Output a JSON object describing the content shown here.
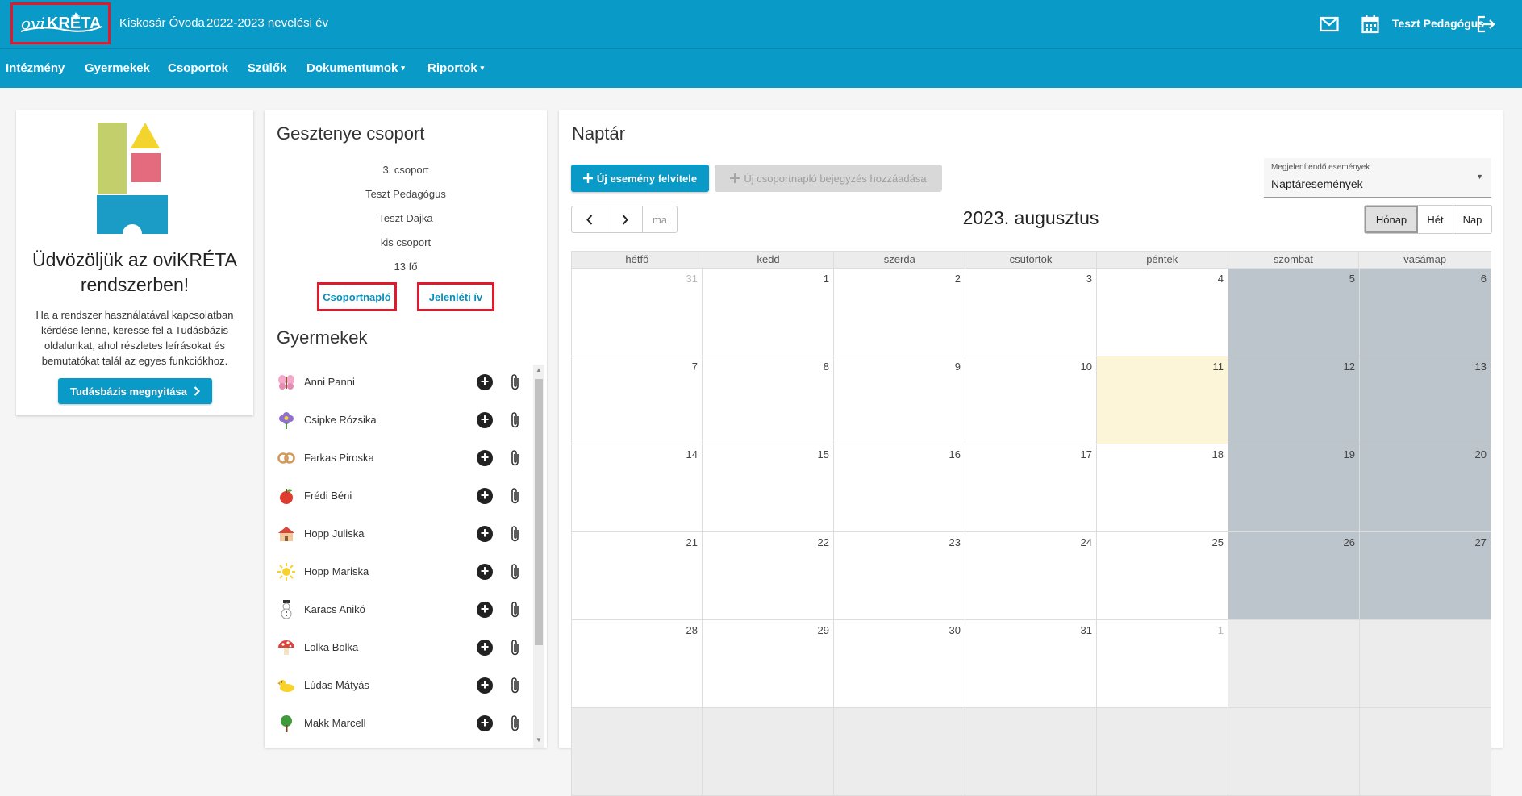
{
  "header": {
    "logo_text": "oviKRÉTA",
    "school": "Kiskosár Óvoda",
    "year": "2022-2023 nevelési év",
    "user": "Teszt Pedagógus",
    "icons": [
      "mail-icon",
      "calendar-icon",
      "logout-icon"
    ]
  },
  "nav": {
    "items": [
      "Intézmény",
      "Gyermekek",
      "Csoportok",
      "Szülők",
      "Dokumentumok",
      "Riportok"
    ],
    "dropdown_caret": "▾"
  },
  "welcome": {
    "title": "Üdvözöljük az oviKRÉTA rendszerben!",
    "text": "Ha a rendszer használatával kapcsolatban kérdése lenne, keresse fel a Tudásbázis oldalunkat, ahol részletes leírásokat és bemutatókat talál az egyes funkciókhoz.",
    "button": "Tudásbázis megnyitása"
  },
  "group": {
    "title": "Gesztenye csoport",
    "number": "3. csoport",
    "teacher": "Teszt Pedagógus",
    "nanny": "Teszt Dajka",
    "type": "kis csoport",
    "size": "13 fő",
    "journal_button": "Csoportnapló",
    "attendance_button": "Jelenléti ív"
  },
  "children": {
    "title": "Gyermekek",
    "list": [
      {
        "name": "Anni Panni",
        "icon": "butterfly-icon"
      },
      {
        "name": "Csipke Rózsika",
        "icon": "flower-icon"
      },
      {
        "name": "Farkas Piroska",
        "icon": "pretzel-icon"
      },
      {
        "name": "Frédi Béni",
        "icon": "apple-icon"
      },
      {
        "name": "Hopp Juliska",
        "icon": "house-icon"
      },
      {
        "name": "Hopp Mariska",
        "icon": "sun-icon"
      },
      {
        "name": "Karacs Anikó",
        "icon": "snowman-icon"
      },
      {
        "name": "Lolka Bolka",
        "icon": "mushroom-icon"
      },
      {
        "name": "Lúdas Mátyás",
        "icon": "duck-icon"
      },
      {
        "name": "Makk Marcell",
        "icon": "tree-icon"
      }
    ]
  },
  "calendar": {
    "title": "Naptár",
    "new_event": "Új esemény felvitele",
    "new_journal": "Új csoportnapló bejegyzés hozzáadása",
    "events_label": "Megjelenítendő események",
    "events_value": "Naptáresemények",
    "today_button": "ma",
    "month": "2023. augusztus",
    "views": [
      "Hónap",
      "Hét",
      "Nap"
    ],
    "weekdays": [
      "hétfő",
      "kedd",
      "szerda",
      "csütörtök",
      "péntek",
      "szombat",
      "vasámap"
    ],
    "weeks": [
      [
        "31",
        "1",
        "2",
        "3",
        "4",
        "5",
        "6"
      ],
      [
        "7",
        "8",
        "9",
        "10",
        "11",
        "12",
        "13"
      ],
      [
        "14",
        "15",
        "16",
        "17",
        "18",
        "19",
        "20"
      ],
      [
        "21",
        "22",
        "23",
        "24",
        "25",
        "26",
        "27"
      ],
      [
        "28",
        "29",
        "30",
        "31",
        "1",
        "",
        ""
      ],
      [
        "",
        "",
        "",
        "",
        "",
        "",
        ""
      ]
    ],
    "today": "11",
    "colors": {
      "accent": "#0a9ac7",
      "weekend": "#bcc5cc",
      "today": "#fdf5d8",
      "highlight": "#e0192c"
    }
  }
}
